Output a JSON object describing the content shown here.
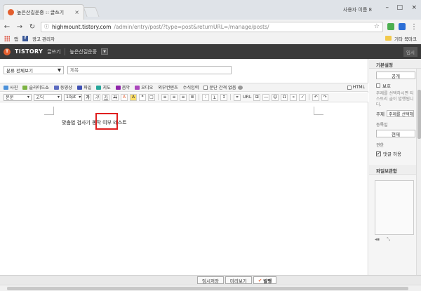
{
  "browser": {
    "tab_title": "높은산길운중 :: 글쓰기",
    "user_name": "사용자 이름 8",
    "url_host": "highmount.tistory.com",
    "url_path": "/admin/entry/post/?type=post&returnURL=/manage/posts/",
    "bookmarks": {
      "apps": "앱",
      "admin": "광고 관리자",
      "other": "기타 북마크"
    }
  },
  "header": {
    "logo": "TISTORY",
    "mode": "글쓰기",
    "blog_name": "높은산길운중",
    "temp": "임시"
  },
  "editor": {
    "category": "분류 전체보기",
    "title_placeholder": "제목",
    "toolbar1": [
      "사진",
      "슬라이드쇼",
      "동영상",
      "파일",
      "지도",
      "음악",
      "오디오",
      "외부컨텐츠",
      "수식입력"
    ],
    "paragraph_label": "문단 간격 없음",
    "html_label": "HTML",
    "style_select": "본문",
    "font_select": "고딕",
    "size_select": "10pt",
    "format_bold": "가",
    "format_italic": "가",
    "format_underline": "가",
    "format_strike": "가",
    "url_label": "URL",
    "body_text": "맞춤법 검사기 동작 여부 테스트"
  },
  "sidebar": {
    "basic_settings": "기본설정",
    "public_button": "공개",
    "protect_label": "보호",
    "protect_help": "주제를 선택하시면 티스토리 글이 발행됩니다.",
    "theme_label": "주제",
    "theme_select": "주제를 선택해주세요",
    "date_label": "등록일",
    "date_button": "현재",
    "permission_label": "권한",
    "comment_allow": "댓글 허용",
    "attach_title": "파일보관함"
  },
  "bottom": {
    "temp_save": "임시저장",
    "preview": "미리보기",
    "publish": "발행"
  },
  "colors": {
    "accent": "#e35e2e",
    "highlight_box": "#e01f1f",
    "header_bg": "#3a3a3a"
  }
}
